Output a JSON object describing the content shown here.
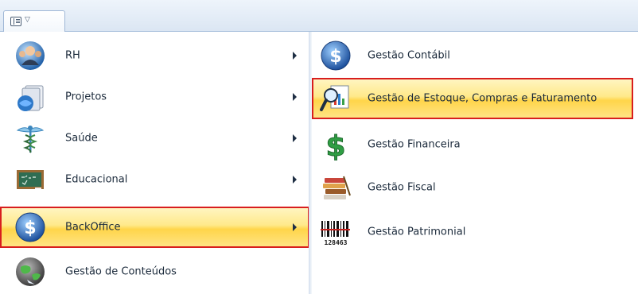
{
  "toolbar": {
    "tab_caret": "▽"
  },
  "left_menu": [
    {
      "label": "RH",
      "icon": "people-globe-icon",
      "submenu": true
    },
    {
      "label": "Projetos",
      "icon": "projects-icon",
      "submenu": true
    },
    {
      "label": "Saúde",
      "icon": "caduceus-icon",
      "submenu": true
    },
    {
      "label": "Educacional",
      "icon": "chalkboard-icon",
      "submenu": true
    },
    {
      "label": "BackOffice",
      "icon": "dollar-coin-icon",
      "submenu": true,
      "active": true
    },
    {
      "label": "Gestão de Conteúdos",
      "icon": "globe-icon",
      "submenu": false
    }
  ],
  "right_menu": [
    {
      "label": "Gestão Contábil",
      "icon": "dollar-coin-icon"
    },
    {
      "label": "Gestão de Estoque, Compras e Faturamento",
      "icon": "magnifier-chart-icon",
      "active": true
    },
    {
      "label": "Gestão Financeira",
      "icon": "dollar-sign-icon"
    },
    {
      "label": "Gestão Fiscal",
      "icon": "stack-of-books-icon"
    },
    {
      "label": "Gestão Patrimonial",
      "icon": "barcode-icon",
      "barcode_text": "128463"
    }
  ],
  "colors": {
    "highlight": "#ffe98a",
    "highlight_border": "#d81e1e",
    "arrow": "#1f2f44"
  }
}
